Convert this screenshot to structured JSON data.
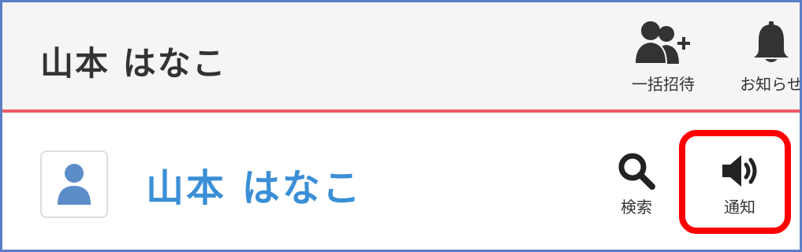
{
  "header": {
    "title": "山本 はなこ",
    "accent_color": "#ef5b63",
    "background": "#f5f5f5",
    "actions": [
      {
        "label": "一括招待",
        "icon": "users-add-icon"
      },
      {
        "label": "お知らせ",
        "icon": "bell-icon"
      }
    ]
  },
  "profile": {
    "name": "山本 はなこ",
    "name_color": "#3b8fd6",
    "avatar_icon": "user-icon",
    "actions": [
      {
        "label": "検索",
        "icon": "search-icon"
      },
      {
        "label": "通知",
        "icon": "speaker-icon"
      }
    ]
  },
  "annotation": {
    "highlight_color": "#ff0000"
  }
}
